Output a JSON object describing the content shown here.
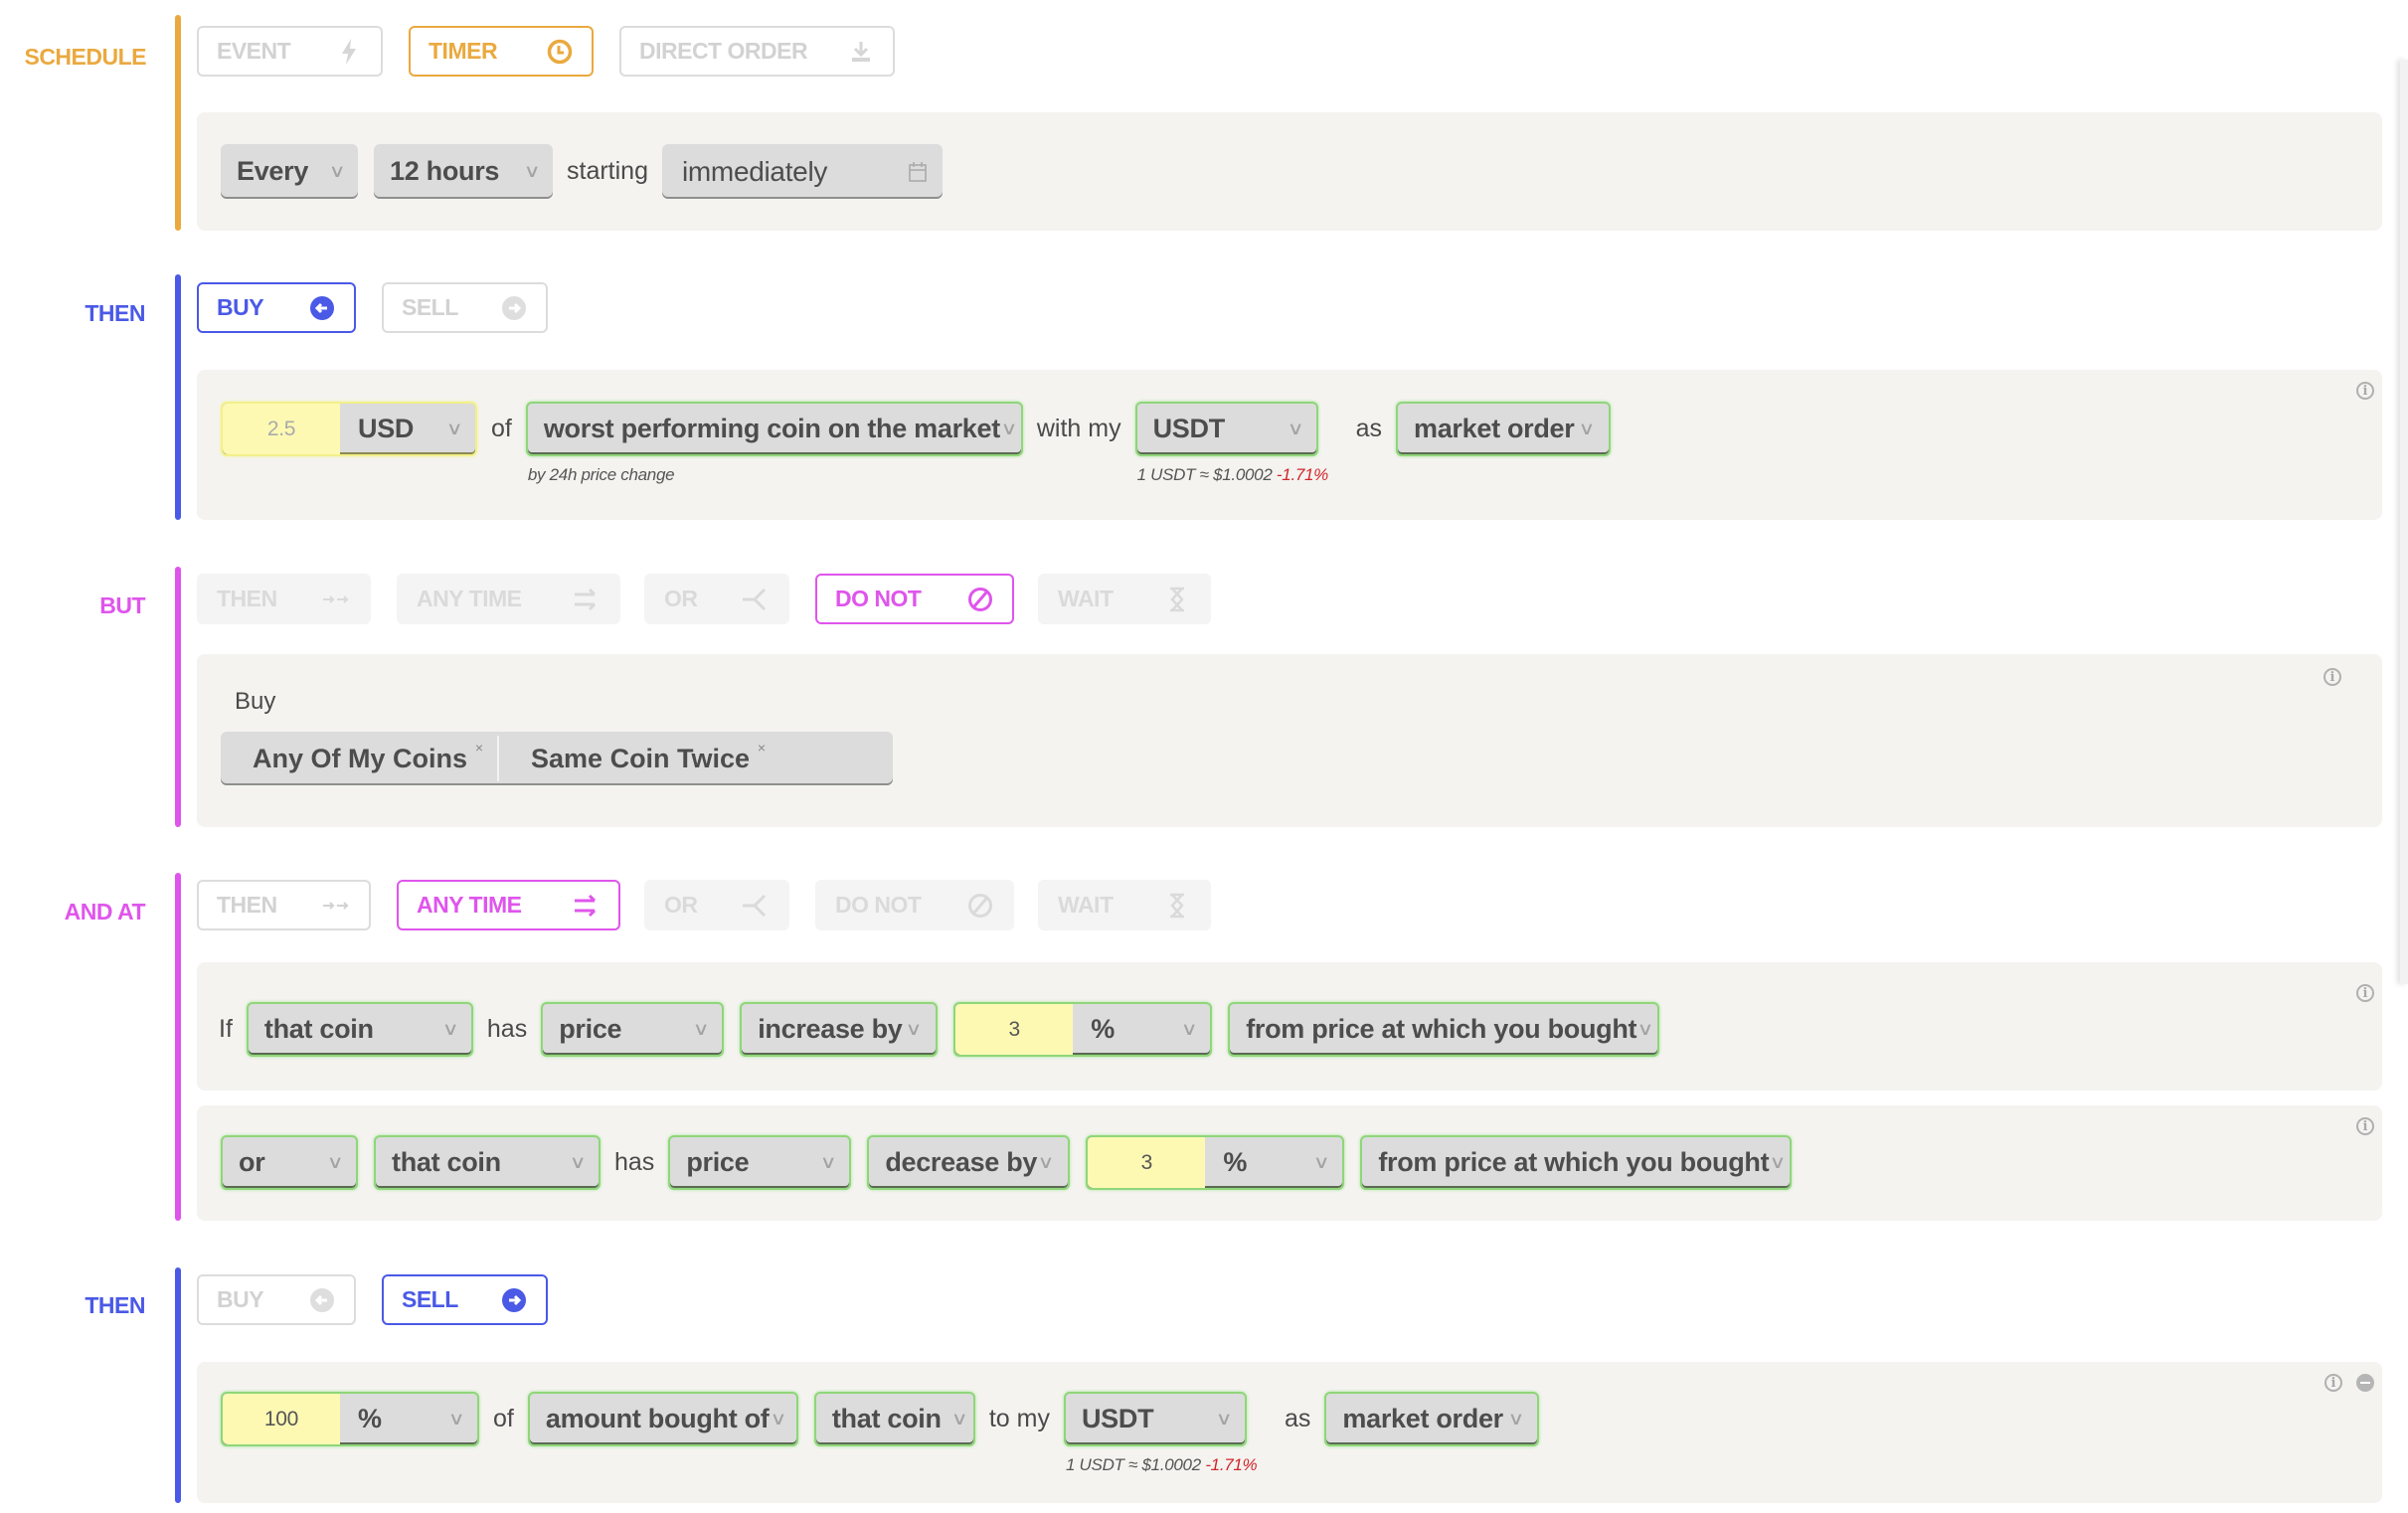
{
  "colors": {
    "schedule": "#eaa93f",
    "then": "#4a59e6",
    "but": "#df55ec",
    "andat": "#df55ec",
    "negative": "#d0262a",
    "number_bg": "#fdf9b3",
    "valid_border": "#8fd67a",
    "panel_bg": "#f4f3f0"
  },
  "schedule": {
    "label": "SCHEDULE",
    "buttons": [
      {
        "label": "EVENT",
        "icon": "lightning-icon",
        "active": false
      },
      {
        "label": "TIMER",
        "icon": "clock-icon",
        "active": true
      },
      {
        "label": "DIRECT ORDER",
        "icon": "download-icon",
        "active": false
      }
    ],
    "frequency": "Every",
    "interval": "12 hours",
    "starting_label": "starting",
    "start": "immediately",
    "start_icon": "calendar-icon"
  },
  "then1": {
    "label": "THEN",
    "buttons": [
      {
        "label": "BUY",
        "icon": "arrow-left-circle-icon",
        "active": true
      },
      {
        "label": "SELL",
        "icon": "arrow-right-circle-icon",
        "active": false
      }
    ],
    "amount": "2.5",
    "amount_unit": "USD",
    "of_label": "of",
    "target": "worst performing coin on the market",
    "target_hint": "by 24h price change",
    "with_label": "with my",
    "currency": "USDT",
    "rate_text": "1 USDT ≈ $1.0002",
    "rate_change": "-1.71%",
    "as_label": "as",
    "order_type": "market order"
  },
  "but": {
    "label": "BUT",
    "buttons": [
      {
        "label": "THEN",
        "icon": "double-arrow-right-icon",
        "active": false
      },
      {
        "label": "ANY TIME",
        "icon": "swap-arrows-icon",
        "active": false
      },
      {
        "label": "OR",
        "icon": "fork-icon",
        "active": false
      },
      {
        "label": "DO NOT",
        "icon": "prohibited-icon",
        "active": true
      },
      {
        "label": "WAIT",
        "icon": "hourglass-icon",
        "active": false
      }
    ],
    "action_label": "Buy",
    "tags": [
      {
        "label": "Any Of My Coins",
        "remove": "×"
      },
      {
        "label": "Same Coin Twice",
        "remove": "×"
      }
    ]
  },
  "andat": {
    "label": "AND AT",
    "buttons": [
      {
        "label": "THEN",
        "icon": "double-arrow-right-icon",
        "active": false
      },
      {
        "label": "ANY TIME",
        "icon": "swap-arrows-icon",
        "active": true
      },
      {
        "label": "OR",
        "icon": "fork-icon",
        "active": false
      },
      {
        "label": "DO NOT",
        "icon": "prohibited-icon",
        "active": false
      },
      {
        "label": "WAIT",
        "icon": "hourglass-icon",
        "active": false
      }
    ],
    "conditions": [
      {
        "prefix": "If",
        "subject": "that coin",
        "has_label": "has",
        "metric": "price",
        "direction": "increase by",
        "value": "3",
        "unit": "%",
        "reference": "from price at which you bought"
      },
      {
        "prefix": "or",
        "subject": "that coin",
        "has_label": "has",
        "metric": "price",
        "direction": "decrease by",
        "value": "3",
        "unit": "%",
        "reference": "from price at which you bought"
      }
    ]
  },
  "then2": {
    "label": "THEN",
    "buttons": [
      {
        "label": "BUY",
        "icon": "arrow-left-circle-icon",
        "active": false
      },
      {
        "label": "SELL",
        "icon": "arrow-right-circle-icon",
        "active": true
      }
    ],
    "amount": "100",
    "amount_unit": "%",
    "of_label": "of",
    "basis": "amount bought of",
    "subject": "that coin",
    "to_label": "to my",
    "currency": "USDT",
    "rate_text": "1 USDT ≈ $1.0002",
    "rate_change": "-1.71%",
    "as_label": "as",
    "order_type": "market order"
  },
  "chevron": "∨",
  "info_glyph": "i"
}
